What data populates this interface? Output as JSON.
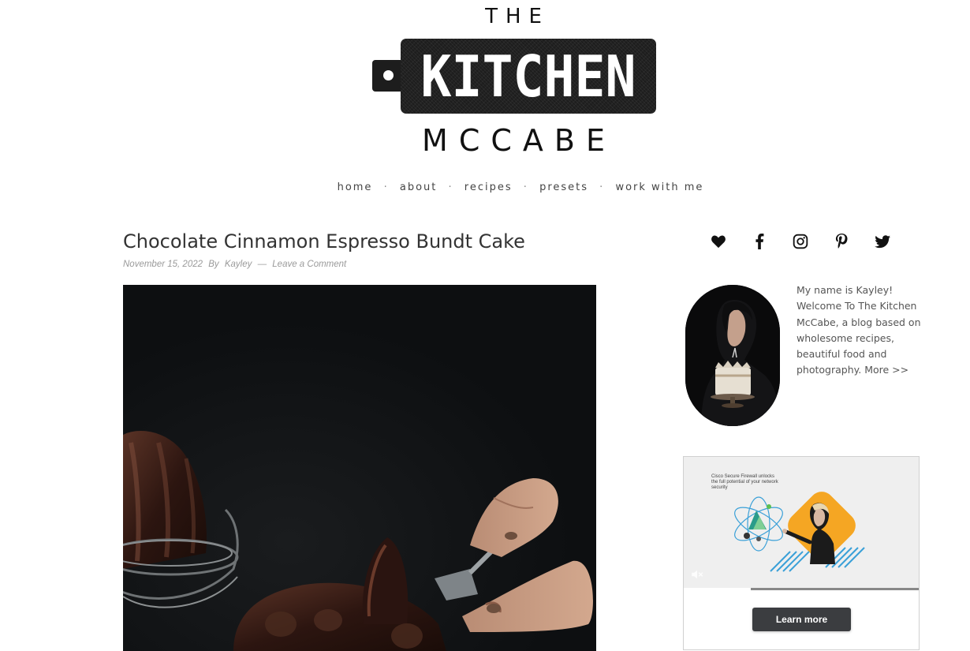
{
  "logo": {
    "top": "THE",
    "middle": "KITCHEN",
    "bottom": "MCCABE"
  },
  "nav": {
    "items": [
      "home",
      "about",
      "recipes",
      "presets",
      "work with me"
    ],
    "separator": "·"
  },
  "post": {
    "title": "Chocolate Cinnamon Espresso Bundt Cake",
    "date": "November 15, 2022",
    "by_label": "By",
    "author": "Kayley",
    "dash": "—",
    "comment_link": "Leave a Comment"
  },
  "social": {
    "icons": [
      "heart-icon",
      "facebook-icon",
      "instagram-icon",
      "pinterest-icon",
      "twitter-icon"
    ]
  },
  "about": {
    "text": "My name is  Kayley! Welcome To The  Kitchen McCabe, a blog based on wholesome recipes, beautiful food and photography. ",
    "more_link": "More >>"
  },
  "ad": {
    "headline": "Cisco Secure Firewall unlocks the full potential of your network security",
    "cta": "Learn more",
    "accent_color": "#f5a623"
  }
}
